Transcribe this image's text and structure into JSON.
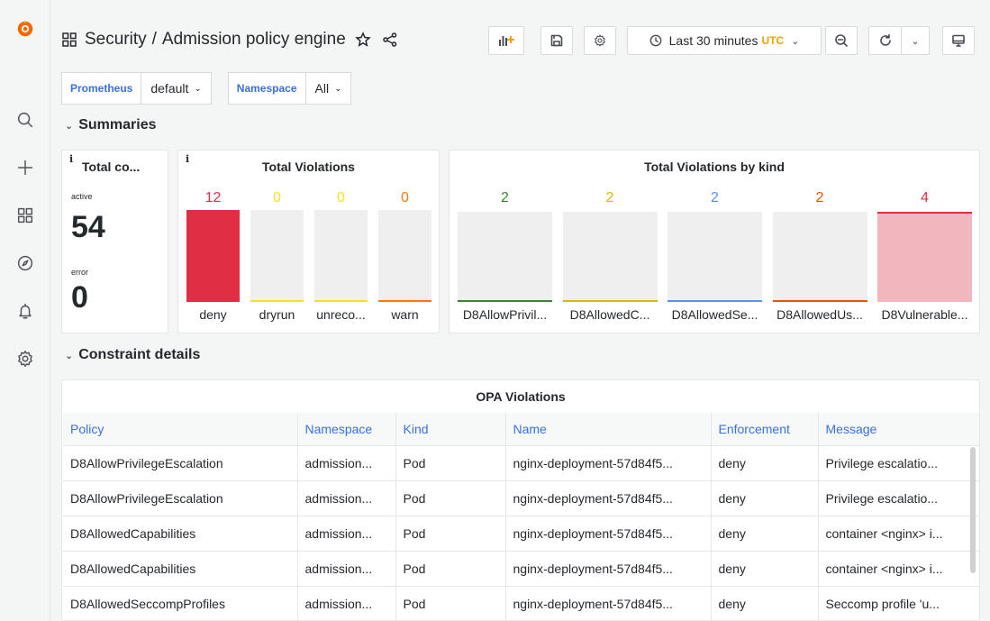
{
  "sidebar": {
    "items": [
      {
        "name": "grafana-logo-icon"
      },
      {
        "name": "search-icon"
      },
      {
        "name": "plus-icon"
      },
      {
        "name": "dashboards-icon"
      },
      {
        "name": "explore-icon"
      },
      {
        "name": "alerting-bell-icon"
      },
      {
        "name": "settings-gear-icon"
      }
    ]
  },
  "header": {
    "folder": "Security",
    "separator": "/",
    "title": "Admission policy engine",
    "time_range": "Last 30 minutes",
    "timezone": "UTC"
  },
  "variables": [
    {
      "label": "Prometheus",
      "value": "default"
    },
    {
      "label": "Namespace",
      "value": "All"
    }
  ],
  "rows": {
    "summaries": "Summaries",
    "constraint_details": "Constraint details"
  },
  "panels": {
    "total_constraints": {
      "info": "i",
      "title": "Total co...",
      "active_label": "active",
      "active_value": "54",
      "error_label": "error",
      "error_value": "0"
    },
    "total_violations": {
      "info": "i",
      "title": "Total Violations",
      "bars": [
        {
          "label": "deny",
          "value": "12",
          "color": "#e02f44",
          "fill": 1.0
        },
        {
          "label": "dryrun",
          "value": "0",
          "color": "#fade2a",
          "fill": 0
        },
        {
          "label": "unreco...",
          "value": "0",
          "color": "#fade2a",
          "fill": 0
        },
        {
          "label": "warn",
          "value": "0",
          "color": "#ff780a",
          "fill": 0
        }
      ]
    },
    "violations_by_kind": {
      "title": "Total Violations by kind",
      "bars": [
        {
          "label": "D8AllowPrivil...",
          "value": "2",
          "color": "#37872d",
          "fill": 0
        },
        {
          "label": "D8AllowedC...",
          "value": "2",
          "color": "#e0b400",
          "fill": 0
        },
        {
          "label": "D8AllowedSe...",
          "value": "2",
          "color": "#5794f2",
          "fill": 0
        },
        {
          "label": "D8AllowedUs...",
          "value": "2",
          "color": "#e55400",
          "fill": 0
        },
        {
          "label": "D8Vulnerable...",
          "value": "4",
          "color": "#e02f44",
          "fill": 1.0
        }
      ]
    }
  },
  "table": {
    "title": "OPA Violations",
    "columns": [
      "Policy",
      "Namespace",
      "Kind",
      "Name",
      "Enforcement",
      "Message"
    ],
    "rows": [
      [
        "D8AllowPrivilegeEscalation",
        "admission...",
        "Pod",
        "nginx-deployment-57d84f5...",
        "deny",
        "Privilege escalatio..."
      ],
      [
        "D8AllowPrivilegeEscalation",
        "admission...",
        "Pod",
        "nginx-deployment-57d84f5...",
        "deny",
        "Privilege escalatio..."
      ],
      [
        "D8AllowedCapabilities",
        "admission...",
        "Pod",
        "nginx-deployment-57d84f5...",
        "deny",
        "container <nginx> i..."
      ],
      [
        "D8AllowedCapabilities",
        "admission...",
        "Pod",
        "nginx-deployment-57d84f5...",
        "deny",
        "container <nginx> i..."
      ],
      [
        "D8AllowedSeccompProfiles",
        "admission...",
        "Pod",
        "nginx-deployment-57d84f5...",
        "deny",
        "Seccomp profile 'u..."
      ]
    ]
  },
  "colors": {
    "accent": "#3871dc",
    "utc": "#f2a003",
    "red": "#e02f44"
  }
}
